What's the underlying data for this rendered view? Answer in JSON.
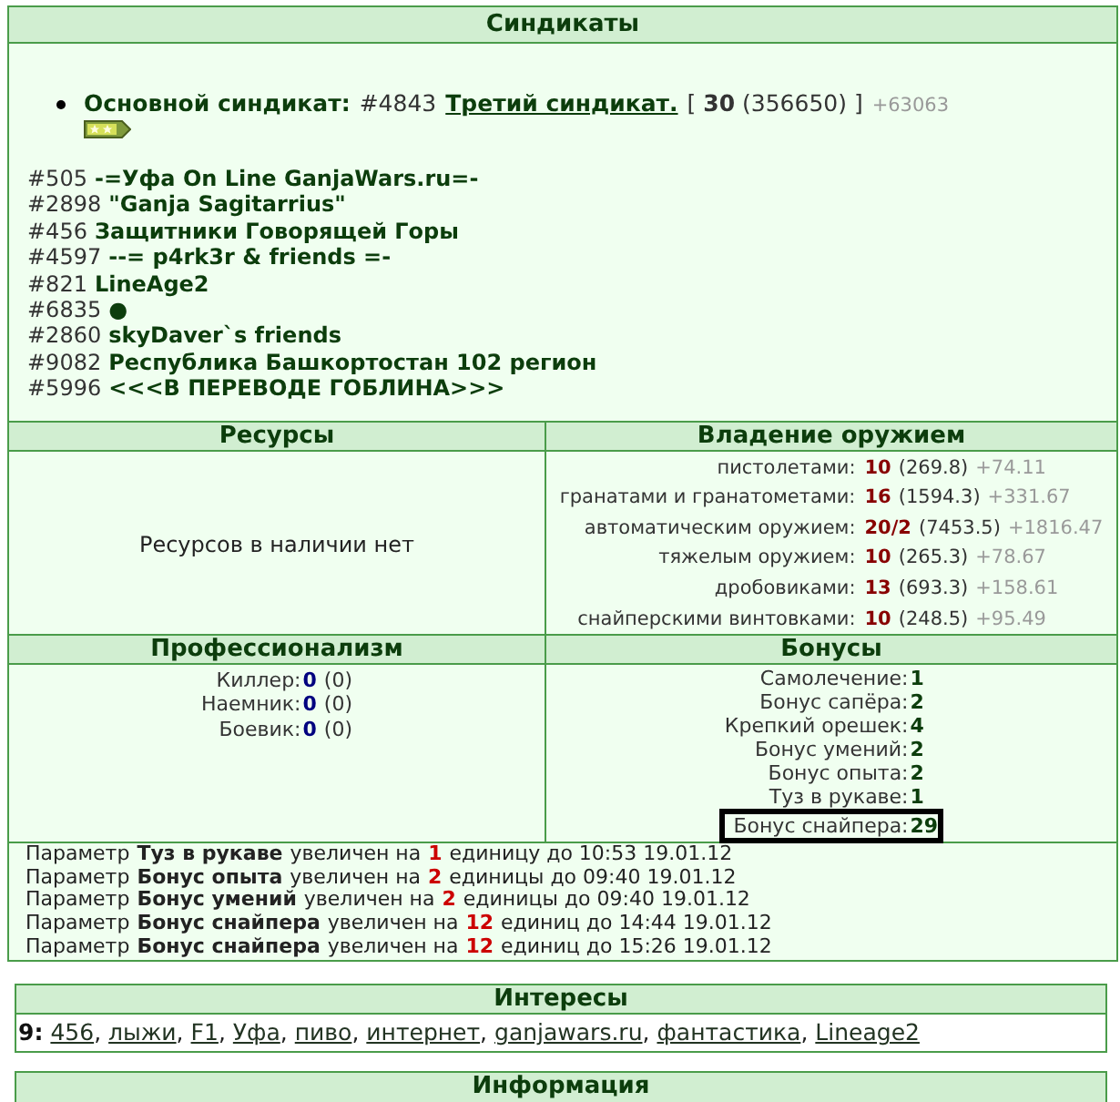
{
  "syndicates": {
    "title": "Синдикаты",
    "main": {
      "label": "Основной синдикат:",
      "number": "#4843",
      "name": "Третий синдикат.",
      "stats": "[ **30** (356650) ]",
      "gain": "+63063"
    },
    "list": [
      {
        "number": "#505",
        "name": "-=Уфа On Line GanjaWars.ru=-"
      },
      {
        "number": "#2898",
        "name": "\"Ganja Sagitarrius\""
      },
      {
        "number": "#456",
        "name": "Защитники Говорящей Горы"
      },
      {
        "number": "#4597",
        "name": "--= p4rk3r & friends =-"
      },
      {
        "number": "#821",
        "name": "LineAge2"
      },
      {
        "number": "#6835",
        "name": "●"
      },
      {
        "number": "#2860",
        "name": "skyDaver`s friends"
      },
      {
        "number": "#9082",
        "name": "Республика Башкортостан 102 регион"
      },
      {
        "number": "#5996",
        "name": "<<<В ПЕРЕВОДЕ ГОБЛИНА>>>"
      }
    ]
  },
  "resources": {
    "title": "Ресурсы",
    "empty_text": "Ресурсов в наличии нет"
  },
  "weapons": {
    "title": "Владение оружием",
    "rows": [
      {
        "label": "пистолетами:",
        "skill": "10",
        "exp": "(269.8)",
        "gain": "+74.11"
      },
      {
        "label": "гранатами и гранатометами:",
        "skill": "16",
        "exp": "(1594.3)",
        "gain": "+331.67"
      },
      {
        "label": "автоматическим оружием:",
        "skill": "20/2",
        "exp": "(7453.5)",
        "gain": "+1816.47"
      },
      {
        "label": "тяжелым оружием:",
        "skill": "10",
        "exp": "(265.3)",
        "gain": "+78.67"
      },
      {
        "label": "дробовиками:",
        "skill": "13",
        "exp": "(693.3)",
        "gain": "+158.61"
      },
      {
        "label": "снайперскими винтовками:",
        "skill": "10",
        "exp": "(248.5)",
        "gain": "+95.49"
      }
    ]
  },
  "professionalism": {
    "title": "Профессионализм",
    "rows": [
      {
        "label": "Киллер:",
        "value": "0",
        "points": "(0)"
      },
      {
        "label": "Наемник:",
        "value": "0",
        "points": "(0)"
      },
      {
        "label": "Боевик:",
        "value": "0",
        "points": "(0)"
      }
    ]
  },
  "bonuses": {
    "title": "Бонусы",
    "rows": [
      {
        "label": "Самолечение:",
        "value": "1",
        "highlighted": false
      },
      {
        "label": "Бонус сапёра:",
        "value": "2",
        "highlighted": false
      },
      {
        "label": "Крепкий орешек:",
        "value": "4",
        "highlighted": false
      },
      {
        "label": "Бонус умений:",
        "value": "2",
        "highlighted": false
      },
      {
        "label": "Бонус опыта:",
        "value": "2",
        "highlighted": false
      },
      {
        "label": "Туз в рукаве:",
        "value": "1",
        "highlighted": false
      },
      {
        "label": "Бонус снайпера:",
        "value": "29",
        "highlighted": true
      }
    ]
  },
  "bonus_log": [
    {
      "before": "Параметр",
      "param": "Туз в рукаве",
      "middle": "увеличен на",
      "amount": "1",
      "after": "единицу до 10:53 19.01.12"
    },
    {
      "before": "Параметр",
      "param": "Бонус опыта",
      "middle": "увеличен на",
      "amount": "2",
      "after": "единицы до 09:40 19.01.12"
    },
    {
      "before": "Параметр",
      "param": "Бонус умений",
      "middle": "увеличен на",
      "amount": "2",
      "after": "единицы до 09:40 19.01.12"
    },
    {
      "before": "Параметр",
      "param": "Бонус снайпера",
      "middle": "увеличен на",
      "amount": "12",
      "after": "единиц до 14:44 19.01.12"
    },
    {
      "before": "Параметр",
      "param": "Бонус снайпера",
      "middle": "увеличен на",
      "amount": "12",
      "after": "единиц до 15:26 19.01.12"
    }
  ],
  "interests": {
    "title": "Интересы",
    "count": "9:",
    "separator": ",",
    "items": [
      "456",
      "лыжи",
      "F1",
      "Уфа",
      "пиво",
      "интернет",
      "ganjawars.ru",
      "фантастика",
      "Lineage2"
    ]
  },
  "information": {
    "title": "Информация"
  }
}
